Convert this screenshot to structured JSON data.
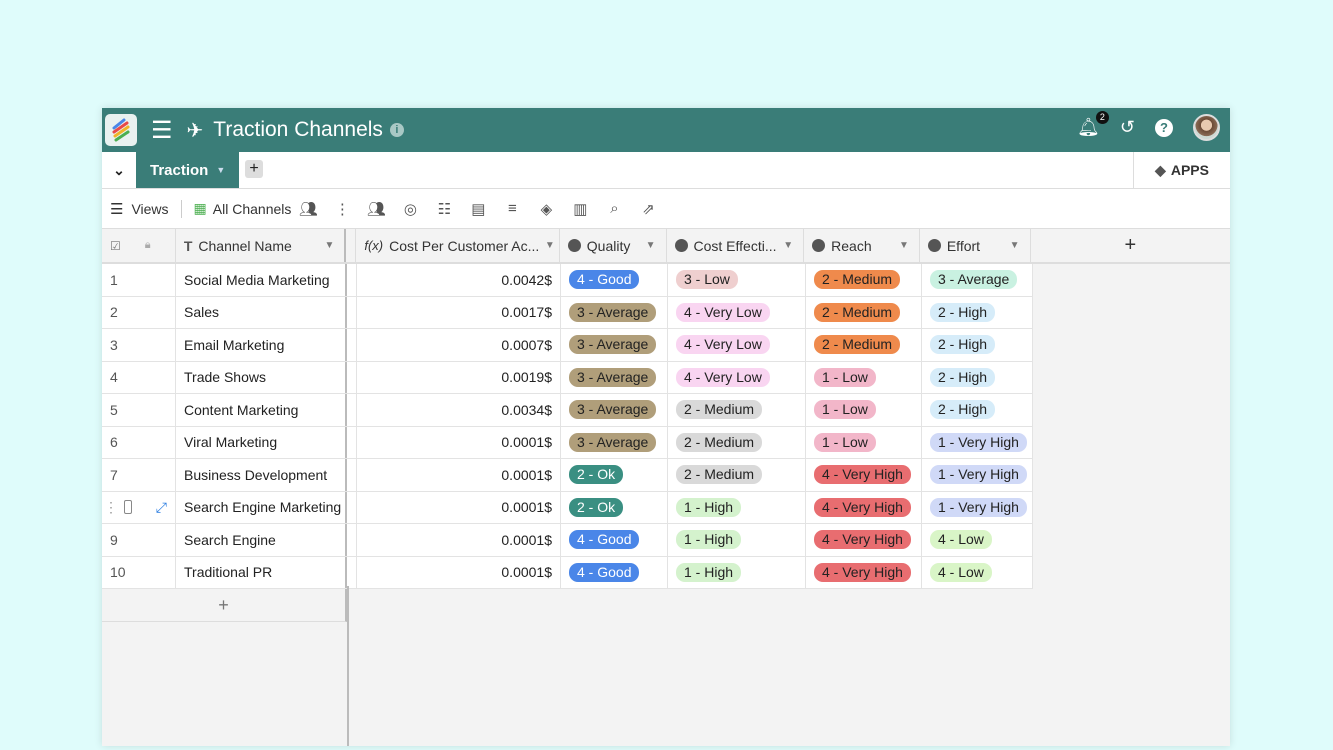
{
  "header": {
    "title": "Traction Channels",
    "notification_count": "2",
    "icons": [
      "app-logo",
      "menu-icon",
      "rocket-icon",
      "info-icon",
      "bell-icon",
      "history-icon",
      "help-icon",
      "avatar"
    ]
  },
  "tabs": {
    "active": "Traction",
    "apps_label": "APPS"
  },
  "toolbar": {
    "views_label": "Views",
    "view_name": "All Channels"
  },
  "columns": {
    "name": "Channel Name",
    "cost": "Cost Per Customer Ac...",
    "quality": "Quality",
    "cost_eff": "Cost Effecti...",
    "reach": "Reach",
    "effort": "Effort"
  },
  "colors": {
    "header": "#3a7d78",
    "background": "#dffcfb"
  },
  "pill_colors": {
    "4 - Good": [
      "#4a86e8",
      "#fff"
    ],
    "3 - Average": [
      "#b09e7a",
      "#222"
    ],
    "2 - Ok": [
      "#3a8f82",
      "#fff"
    ],
    "3 - Low": [
      "#efcfcf",
      "#222"
    ],
    "4 - Very Low": [
      "#f9d5f1",
      "#222"
    ],
    "2 - Medium": [
      "#d9d9d9",
      "#222"
    ],
    "1 - High": [
      "#d4f2cd",
      "#222"
    ],
    "R:2 - Medium": [
      "#ef8a4c",
      "#222"
    ],
    "R:1 - Low": [
      "#f2b6c9",
      "#222"
    ],
    "R:4 - Very High": [
      "#e86d70",
      "#222"
    ],
    "E:3 - Average": [
      "#c9f1e1",
      "#222"
    ],
    "E:2 - High": [
      "#d6ecf9",
      "#222"
    ],
    "E:1 - Very High": [
      "#d0d9f7",
      "#222"
    ],
    "E:4 - Low": [
      "#d9f5c7",
      "#222"
    ]
  },
  "rows": [
    {
      "num": "1",
      "name": "Social Media Marketing",
      "cost": "0.0042$",
      "quality": "4 - Good",
      "cost_eff": "3 - Low",
      "reach": "2 - Medium",
      "effort": "3 - Average"
    },
    {
      "num": "2",
      "name": "Sales",
      "cost": "0.0017$",
      "quality": "3 - Average",
      "cost_eff": "4 - Very Low",
      "reach": "2 - Medium",
      "effort": "2 - High"
    },
    {
      "num": "3",
      "name": "Email Marketing",
      "cost": "0.0007$",
      "quality": "3 - Average",
      "cost_eff": "4 - Very Low",
      "reach": "2 - Medium",
      "effort": "2 - High"
    },
    {
      "num": "4",
      "name": "Trade Shows",
      "cost": "0.0019$",
      "quality": "3 - Average",
      "cost_eff": "4 - Very Low",
      "reach": "1 - Low",
      "effort": "2 - High"
    },
    {
      "num": "5",
      "name": "Content Marketing",
      "cost": "0.0034$",
      "quality": "3 - Average",
      "cost_eff": "2 - Medium",
      "reach": "1 - Low",
      "effort": "2 - High"
    },
    {
      "num": "6",
      "name": "Viral Marketing",
      "cost": "0.0001$",
      "quality": "3 - Average",
      "cost_eff": "2 - Medium",
      "reach": "1 - Low",
      "effort": "1 - Very High"
    },
    {
      "num": "7",
      "name": "Business Development",
      "cost": "0.0001$",
      "quality": "2 - Ok",
      "cost_eff": "2 - Medium",
      "reach": "4 - Very High",
      "effort": "1 - Very High"
    },
    {
      "num": "",
      "name": "Search Engine Marketing",
      "cost": "0.0001$",
      "quality": "2 - Ok",
      "cost_eff": "1 - High",
      "reach": "4 - Very High",
      "effort": "1 - Very High",
      "hovered": true
    },
    {
      "num": "9",
      "name": "Search Engine",
      "cost": "0.0001$",
      "quality": "4 - Good",
      "cost_eff": "1 - High",
      "reach": "4 - Very High",
      "effort": "4 - Low"
    },
    {
      "num": "10",
      "name": "Traditional PR",
      "cost": "0.0001$",
      "quality": "4 - Good",
      "cost_eff": "1 - High",
      "reach": "4 - Very High",
      "effort": "4 - Low"
    }
  ]
}
